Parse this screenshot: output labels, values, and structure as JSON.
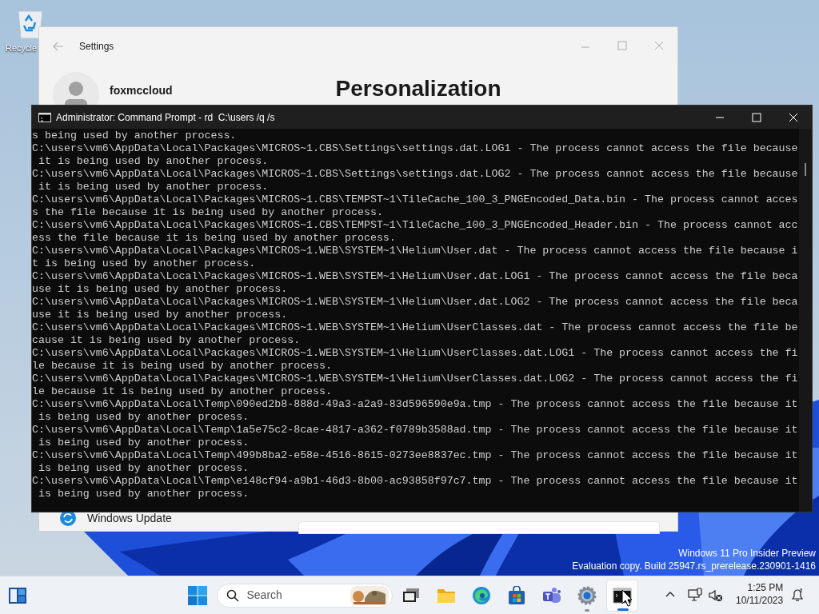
{
  "desktop": {
    "icons": [
      {
        "label": "Recycle"
      }
    ],
    "watermark": [
      "Windows 11 Pro Insider Preview",
      "Evaluation copy. Build 25947.rs_prerelease.230901-1416"
    ]
  },
  "settings_window": {
    "title": "Settings",
    "account": {
      "name": "foxmccloud"
    },
    "page_title": "Personalization",
    "nav_items": [
      {
        "label": "Windows Update"
      }
    ]
  },
  "console_window": {
    "title": "Administrator: Command Prompt - rd  C:\\users /q /s",
    "lines": [
      "s being used by another process.",
      "C:\\users\\vm6\\AppData\\Local\\Packages\\MICROS~1.CBS\\Settings\\settings.dat.LOG1 - The process cannot access the file because",
      " it is being used by another process.",
      "C:\\users\\vm6\\AppData\\Local\\Packages\\MICROS~1.CBS\\Settings\\settings.dat.LOG2 - The process cannot access the file because",
      " it is being used by another process.",
      "C:\\users\\vm6\\AppData\\Local\\Packages\\MICROS~1.CBS\\TEMPST~1\\TileCache_100_3_PNGEncoded_Data.bin - The process cannot acces",
      "s the file because it is being used by another process.",
      "C:\\users\\vm6\\AppData\\Local\\Packages\\MICROS~1.CBS\\TEMPST~1\\TileCache_100_3_PNGEncoded_Header.bin - The process cannot acc",
      "ess the file because it is being used by another process.",
      "C:\\users\\vm6\\AppData\\Local\\Packages\\MICROS~1.WEB\\SYSTEM~1\\Helium\\User.dat - The process cannot access the file because i",
      "t is being used by another process.",
      "C:\\users\\vm6\\AppData\\Local\\Packages\\MICROS~1.WEB\\SYSTEM~1\\Helium\\User.dat.LOG1 - The process cannot access the file beca",
      "use it is being used by another process.",
      "C:\\users\\vm6\\AppData\\Local\\Packages\\MICROS~1.WEB\\SYSTEM~1\\Helium\\User.dat.LOG2 - The process cannot access the file beca",
      "use it is being used by another process.",
      "C:\\users\\vm6\\AppData\\Local\\Packages\\MICROS~1.WEB\\SYSTEM~1\\Helium\\UserClasses.dat - The process cannot access the file be",
      "cause it is being used by another process.",
      "C:\\users\\vm6\\AppData\\Local\\Packages\\MICROS~1.WEB\\SYSTEM~1\\Helium\\UserClasses.dat.LOG1 - The process cannot access the fi",
      "le because it is being used by another process.",
      "C:\\users\\vm6\\AppData\\Local\\Packages\\MICROS~1.WEB\\SYSTEM~1\\Helium\\UserClasses.dat.LOG2 - The process cannot access the fi",
      "le because it is being used by another process.",
      "C:\\users\\vm6\\AppData\\Local\\Temp\\090ed2b8-888d-49a3-a2a9-83d596590e9a.tmp - The process cannot access the file because it",
      " is being used by another process.",
      "C:\\users\\vm6\\AppData\\Local\\Temp\\1a5e75c2-8cae-4817-a362-f0789b3588ad.tmp - The process cannot access the file because it",
      " is being used by another process.",
      "C:\\users\\vm6\\AppData\\Local\\Temp\\499b8ba2-e58e-4516-8615-0273ee8837ec.tmp - The process cannot access the file because it",
      " is being used by another process.",
      "C:\\users\\vm6\\AppData\\Local\\Temp\\e148cf94-a9b1-46d3-8b00-ac93858f97c7.tmp - The process cannot access the file because it",
      " is being used by another process."
    ]
  },
  "taskbar": {
    "search": {
      "placeholder": "Search"
    },
    "apps": [
      {
        "kind": "task-view",
        "running": false,
        "selected": false
      },
      {
        "kind": "folder",
        "running": false,
        "selected": false
      },
      {
        "kind": "browser",
        "running": false,
        "selected": false
      },
      {
        "kind": "store",
        "running": false,
        "selected": false
      },
      {
        "kind": "teams",
        "running": false,
        "selected": false
      },
      {
        "kind": "settings",
        "running": true,
        "selected": false
      },
      {
        "kind": "terminal",
        "running": true,
        "selected": true
      }
    ],
    "clock": {
      "time": "1:25 PM",
      "date": "10/11/2023"
    }
  }
}
